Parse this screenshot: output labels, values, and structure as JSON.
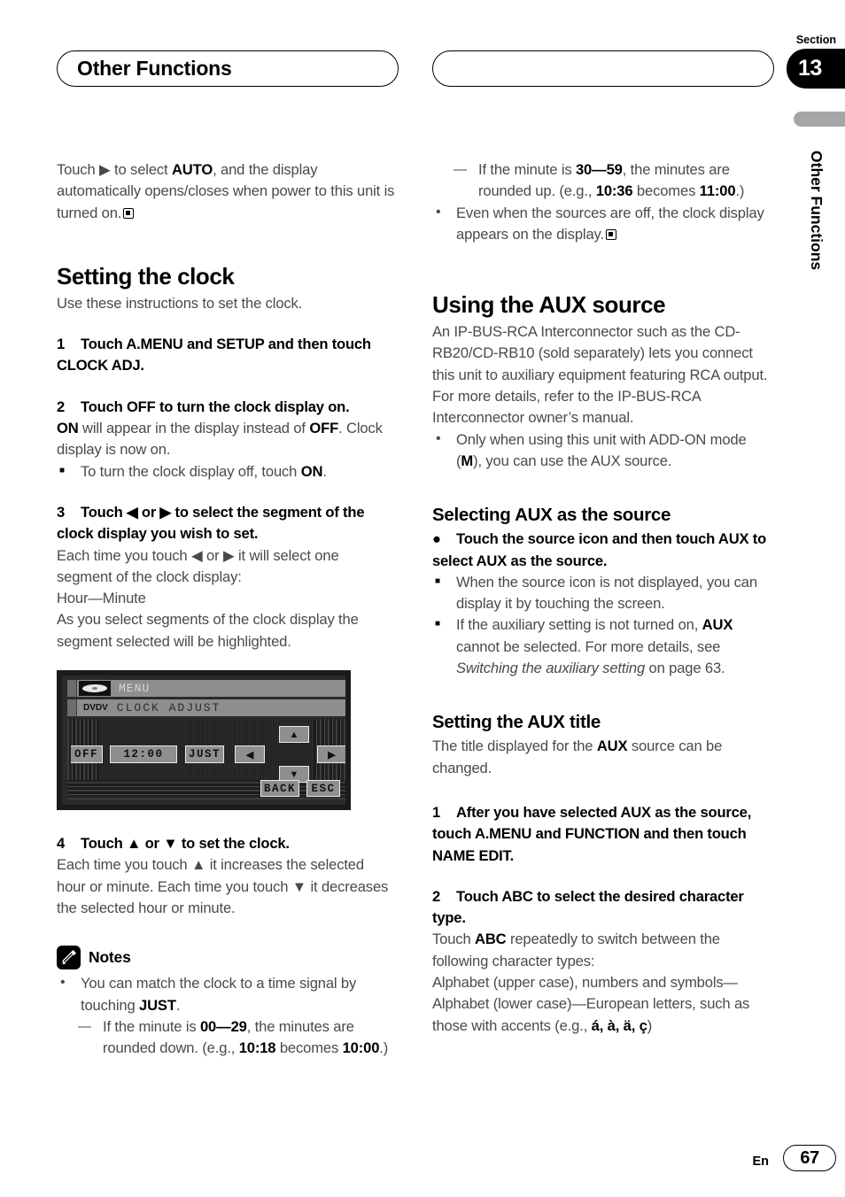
{
  "header": {
    "chapter_title": "Other Functions",
    "section_label": "Section",
    "section_number": "13",
    "running_title": "Other Functions"
  },
  "footer": {
    "language": "En",
    "page_number": "67"
  },
  "left_column": {
    "intro_paragraph": "Touch ▶ to select AUTO, and the display automatically opens/closes when power to this unit is turned on.",
    "intro_bold_1": "AUTO",
    "heading_clock": "Setting the clock",
    "clock_intro": "Use these instructions to set the clock.",
    "step1_num": "1",
    "step1_text": "Touch A.MENU and SETUP and then touch CLOCK ADJ.",
    "step2_num": "2",
    "step2_text": "Touch OFF to turn the clock display on.",
    "step2_body_a": "ON",
    "step2_body_b": " will appear in the display instead of ",
    "step2_body_c": "OFF",
    "step2_body_d": ". Clock display is now on.",
    "step2_note": "To turn the clock display off, touch ON.",
    "step3_num": "3",
    "step3_text": "Touch ◀ or ▶ to select the segment of the clock display you wish to set.",
    "step3_body": "Each time you touch ◀ or ▶ it will select one segment of the clock display:",
    "step3_segments": "Hour—Minute",
    "step3_body2": "As you select segments of the clock display the segment selected will be highlighted.",
    "step4_num": "4",
    "step4_text": "Touch ▲ or ▼ to set the clock.",
    "step4_body": "Each time you touch ▲ it increases the selected hour or minute. Each time you touch ▼ it decreases the selected hour or minute.",
    "notes_title": "Notes",
    "notes_icon": "pencil-icon",
    "note1_a": "You can match the clock to a time signal by touching ",
    "note1_b": "JUST",
    "note1_c": ".",
    "note1_dash_a": "If the minute is ",
    "note1_dash_b": "00—29",
    "note1_dash_c": ", the minutes are rounded down. (e.g., ",
    "note1_dash_d": "10:18",
    "note1_dash_e": " becomes ",
    "note1_dash_f": "10:00",
    "note1_dash_g": ".)"
  },
  "figure": {
    "name": "clock-adjust-screen",
    "menu_label": "MENU",
    "source_icon": "disc-icon",
    "dvd_badge": "DVDV",
    "title": "CLOCK ADJUST",
    "keys": {
      "off": "OFF",
      "time": "12:00",
      "just": "JUST",
      "left": "◀",
      "up": "▲",
      "down": "▼",
      "right": "▶",
      "back": "BACK",
      "esc": "ESC"
    }
  },
  "right_column": {
    "note_top_dash_a": "If the minute is ",
    "note_top_dash_b": "30—59",
    "note_top_dash_c": ", the minutes are rounded up. (e.g., ",
    "note_top_dash_d": "10:36",
    "note_top_dash_e": " becomes ",
    "note_top_dash_f": "11:00",
    "note_top_dash_g": ".)",
    "note_top_bullet": "Even when the sources are off, the clock display appears on the display.",
    "heading_aux": "Using the AUX source",
    "aux_paragraph": "An IP-BUS-RCA Interconnector such as the CD-RB20/CD-RB10 (sold separately) lets you connect this unit to auxiliary equipment featuring RCA output. For more details, refer to the IP-BUS-RCA Interconnector owner’s manual.",
    "aux_bullet_a": "Only when using this unit with ADD-ON mode (",
    "aux_bullet_b": "M",
    "aux_bullet_c": "), you can use the AUX source.",
    "heading_selecting": "Selecting AUX as the source",
    "select_step_text": "Touch the source icon and then touch AUX to select AUX as the source.",
    "select_note1": "When the source icon is not displayed, you can display it by touching the screen.",
    "select_note2_a": "If the auxiliary setting is not turned on, ",
    "select_note2_b": "AUX",
    "select_note2_c": " cannot be selected. For more details, see ",
    "select_note2_d": "Switching the auxiliary setting",
    "select_note2_e": " on page 63.",
    "heading_title": "Setting the AUX title",
    "title_intro_a": "The title displayed for the ",
    "title_intro_b": "AUX",
    "title_intro_c": " source can be changed.",
    "step1_num": "1",
    "step1_text": "After you have selected AUX as the source, touch A.MENU and FUNCTION and then touch NAME EDIT.",
    "step2_num": "2",
    "step2_text": "Touch ABC to select the desired character type.",
    "step2_body_a": "Touch ",
    "step2_body_b": "ABC",
    "step2_body_c": " repeatedly to switch between the following character types:",
    "step2_types": "Alphabet (upper case), numbers and symbols—Alphabet (lower case)—European letters, such as those with accents (e.g., ",
    "step2_accents": "á, à, ä, ç",
    "step2_types_end": ")"
  }
}
